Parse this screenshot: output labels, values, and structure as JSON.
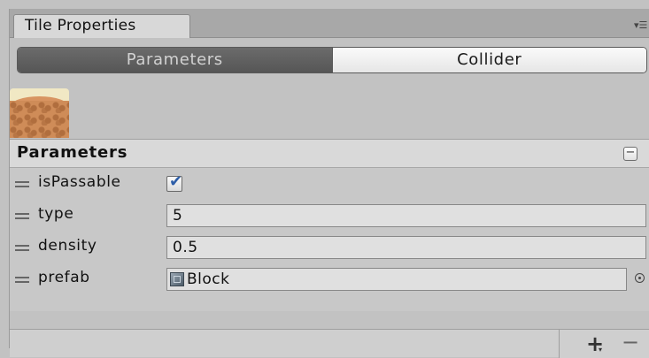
{
  "window": {
    "tab_label": "Tile Properties",
    "menu_icon": "panel-menu-icon"
  },
  "toolbar": {
    "tabs": [
      {
        "label": "Parameters",
        "active": true
      },
      {
        "label": "Collider",
        "active": false
      }
    ]
  },
  "preview": {
    "icon": "tile-preview-image"
  },
  "section": {
    "title": "Parameters",
    "collapse_symbol": "−"
  },
  "fields": {
    "isPassable": {
      "label": "isPassable",
      "checked": true,
      "tick": "✔"
    },
    "type": {
      "label": "type",
      "value": "5"
    },
    "density": {
      "label": "density",
      "value": "0.5"
    },
    "prefab": {
      "label": "prefab",
      "value": "Block",
      "icon": "prefab-cube-icon"
    }
  },
  "footer": {
    "add_symbol": "+",
    "add_caret": "▾",
    "remove_symbol": "−"
  },
  "colors": {
    "panel_bg": "#c2c2c2",
    "active_tab_bg": "#5f5f5f",
    "checkmark": "#2d5ea8"
  }
}
